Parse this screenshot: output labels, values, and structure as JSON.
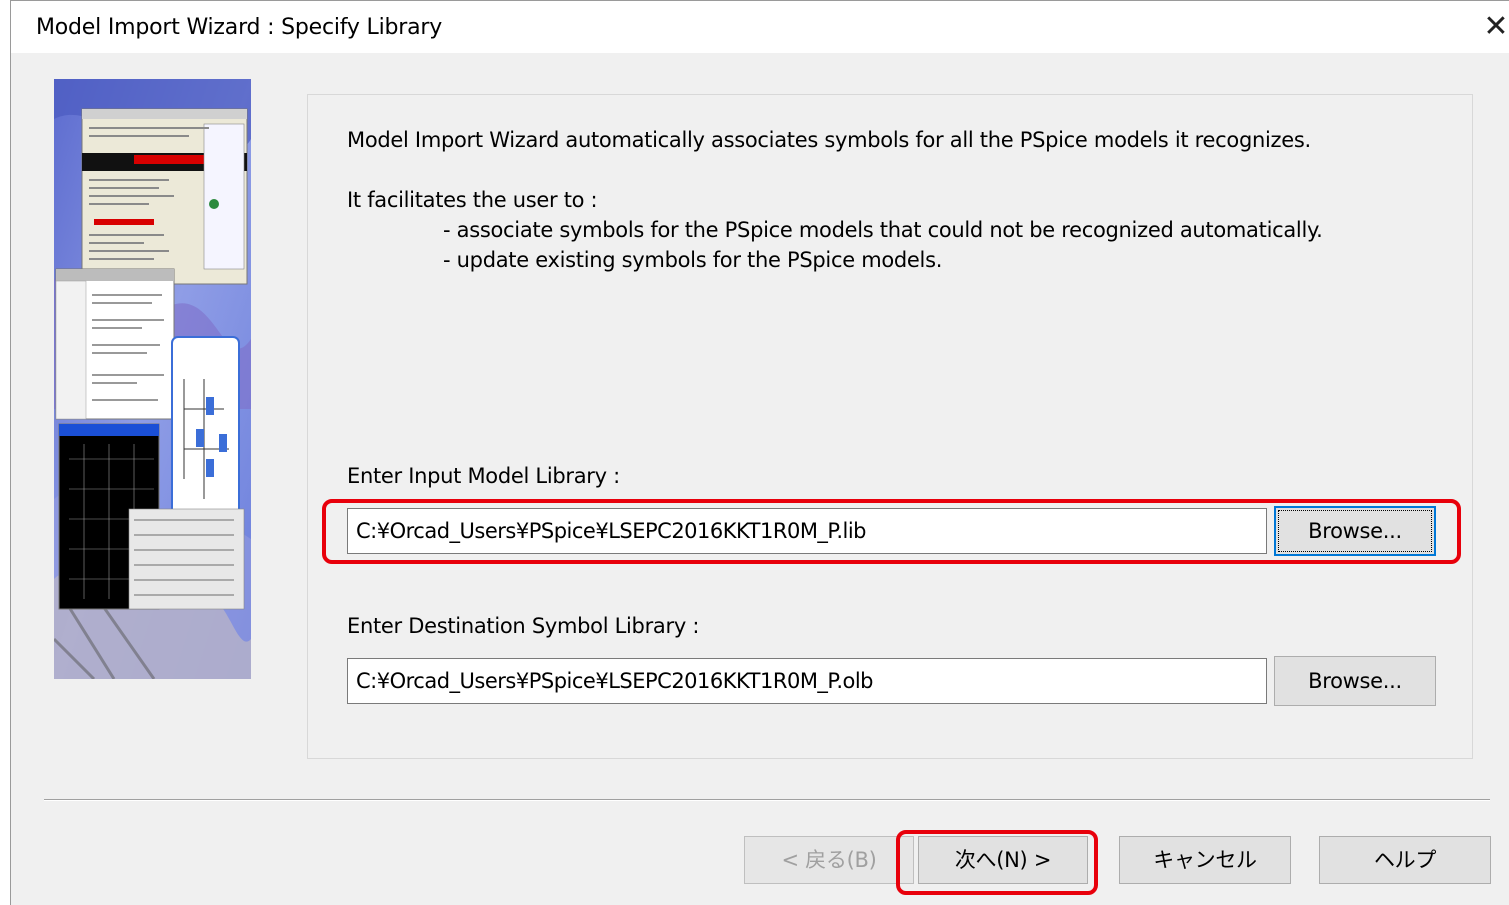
{
  "window": {
    "title": "Model Import Wizard : Specify Library"
  },
  "content": {
    "intro": "Model Import Wizard automatically associates symbols for all the PSpice models it recognizes.",
    "facilitates": "It facilitates the user to :",
    "bullets": [
      "- associate symbols for the PSpice models that could not be recognized automatically.",
      "- update existing symbols for the PSpice models."
    ],
    "input_library": {
      "label": "Enter Input Model Library :",
      "value": "C:¥Orcad_Users¥PSpice¥LSEPC2016KKT1R0M_P.lib",
      "browse_label": "Browse..."
    },
    "destination_library": {
      "label": "Enter Destination Symbol Library :",
      "value": "C:¥Orcad_Users¥PSpice¥LSEPC2016KKT1R0M_P.olb",
      "browse_label": "Browse..."
    }
  },
  "footer": {
    "back_label": "< 戻る(B)",
    "next_label": "次へ(N) >",
    "cancel_label": "キャンセル",
    "help_label": "ヘルプ"
  },
  "colors": {
    "highlight": "#e8000b",
    "focus": "#0078d7",
    "dialog_bg": "#f0f0f0"
  }
}
